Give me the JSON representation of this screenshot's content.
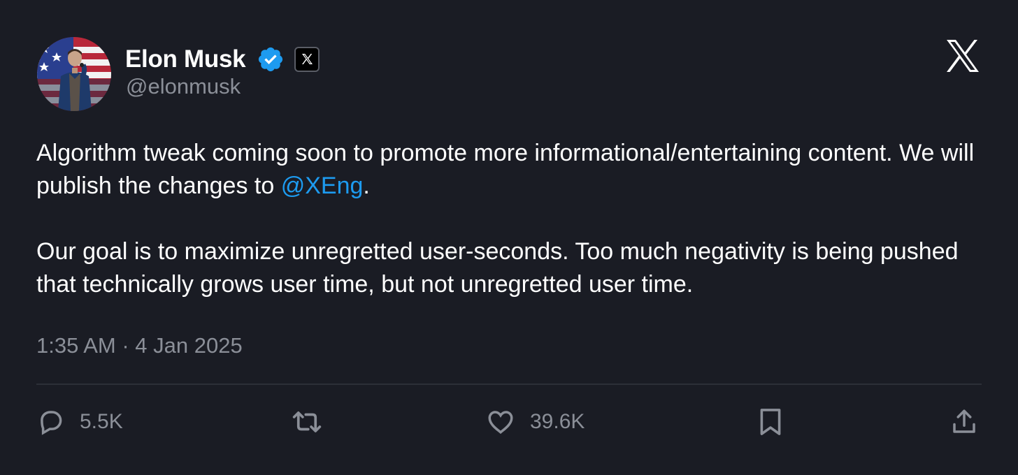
{
  "author": {
    "display_name": "Elon Musk",
    "handle": "@elonmusk",
    "verified": true,
    "verified_color": "#1d9bf0"
  },
  "tweet": {
    "paragraph1_before": "Algorithm tweak coming soon to promote more informational/entertaining content. We will publish the changes to ",
    "mention": "@XEng",
    "paragraph1_after": ".",
    "paragraph2": "Our goal is to maximize unregretted user-seconds. Too much negativity is being pushed that technically grows user time, but not unregretted user time.",
    "timestamp": "1:35 AM · 4 Jan 2025"
  },
  "actions": {
    "reply": {
      "icon": "reply-icon",
      "count": "5.5K"
    },
    "repost": {
      "icon": "repost-icon",
      "count": ""
    },
    "like": {
      "icon": "heart-icon",
      "count": "39.6K"
    },
    "bookmark": {
      "icon": "bookmark-icon"
    },
    "share": {
      "icon": "share-icon"
    }
  },
  "colors": {
    "background": "#1a1c24",
    "text": "#ffffff",
    "secondary_text": "#8b8f98",
    "link": "#1d9bf0",
    "divider": "#2c2f37"
  }
}
